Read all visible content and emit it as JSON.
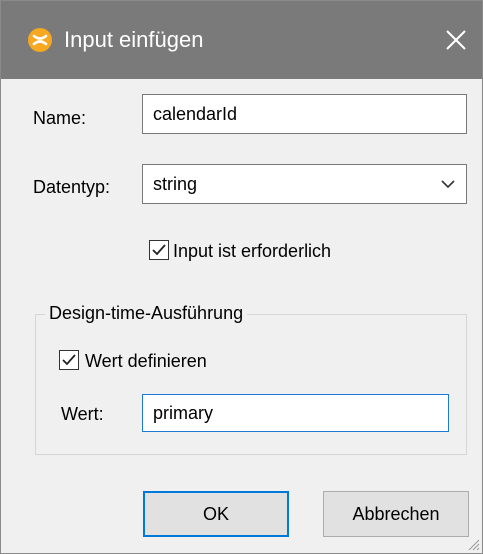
{
  "window": {
    "title": "Input einfügen",
    "icon": "app-logo-icon",
    "close_icon": "close-icon"
  },
  "form": {
    "name_label": "Name:",
    "name_value": "calendarId",
    "datatype_label": "Datentyp:",
    "datatype_value": "string",
    "required_label": "Input ist erforderlich",
    "required_checked": true
  },
  "design_time": {
    "group_title": "Design-time-Ausführung",
    "define_value_label": "Wert definieren",
    "define_value_checked": true,
    "value_label": "Wert:",
    "value": "primary"
  },
  "buttons": {
    "ok": "OK",
    "cancel": "Abbrechen"
  },
  "colors": {
    "titlebar": "#7a7a7a",
    "icon_accent": "#f6a821",
    "focus_border": "#1f78d4",
    "default_button_border": "#0078d7"
  }
}
